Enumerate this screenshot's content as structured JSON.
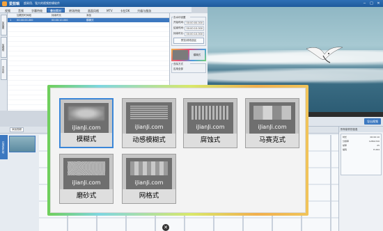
{
  "window": {
    "app_name": "爱剪辑",
    "slogan": "超易用、强大的视频剪辑软件",
    "buttons": [
      "─",
      "□",
      "✕"
    ]
  },
  "tabs": [
    {
      "label": "视频",
      "active": false
    },
    {
      "label": "音频",
      "active": false
    },
    {
      "label": "字幕特效",
      "active": false
    },
    {
      "label": "叠加素材",
      "active": true
    },
    {
      "label": "转场特效",
      "active": false
    },
    {
      "label": "画面风格",
      "active": false
    },
    {
      "label": "MTV",
      "active": false
    },
    {
      "label": "卡拉OK",
      "active": false
    },
    {
      "label": "升级与服务",
      "active": false
    }
  ],
  "sidebar": {
    "items": [
      "加贴图",
      "加相框",
      "去水印"
    ]
  },
  "subtitle_table": {
    "headers": [
      "",
      "加载的时间段",
      "持续时长",
      "添加"
    ],
    "row": {
      "index": "1",
      "start": "00:00:00.000",
      "end": "00:00:10.000",
      "name": "模糊式"
    }
  },
  "fx_panel": {
    "group_title": "去水印设置",
    "fields": [
      {
        "label": "开始时间:",
        "value": "00:00:00.000"
      },
      {
        "label": "结束时间:",
        "value": "00:00:10.000"
      },
      {
        "label": "持续时长:",
        "value": "00:00:10.000"
      }
    ],
    "button": "预览/修改选区",
    "thumb_caption": "模糊式",
    "group2_title": "去除方式",
    "checkbox": "应用全部"
  },
  "preview_controls": {
    "export_label": "导出视频"
  },
  "bottom": {
    "add_video_label": "添加视频",
    "vtab_label": "已添加片段"
  },
  "props": {
    "header": "所有制作的信息",
    "rows": [
      {
        "k": "时长",
        "v": "00:00:10"
      },
      {
        "k": "分辨率",
        "v": "1280x720"
      },
      {
        "k": "帧率",
        "v": "25"
      },
      {
        "k": "编码",
        "v": "H.264"
      }
    ]
  },
  "dialog": {
    "site_text": "iJianJi.com",
    "options": [
      {
        "label": "模糊式",
        "fx": "blur",
        "selected": true
      },
      {
        "label": "动感模糊式",
        "fx": "motion",
        "selected": false
      },
      {
        "label": "腐蚀式",
        "fx": "erode",
        "selected": false
      },
      {
        "label": "马赛克式",
        "fx": "mosaic",
        "selected": false
      },
      {
        "label": "磨砂式",
        "fx": "frost",
        "selected": false
      },
      {
        "label": "网格式",
        "fx": "grid",
        "selected": false
      }
    ]
  },
  "colors": {
    "accent": "#3c78c0",
    "selected_border": "#3a86d8"
  }
}
